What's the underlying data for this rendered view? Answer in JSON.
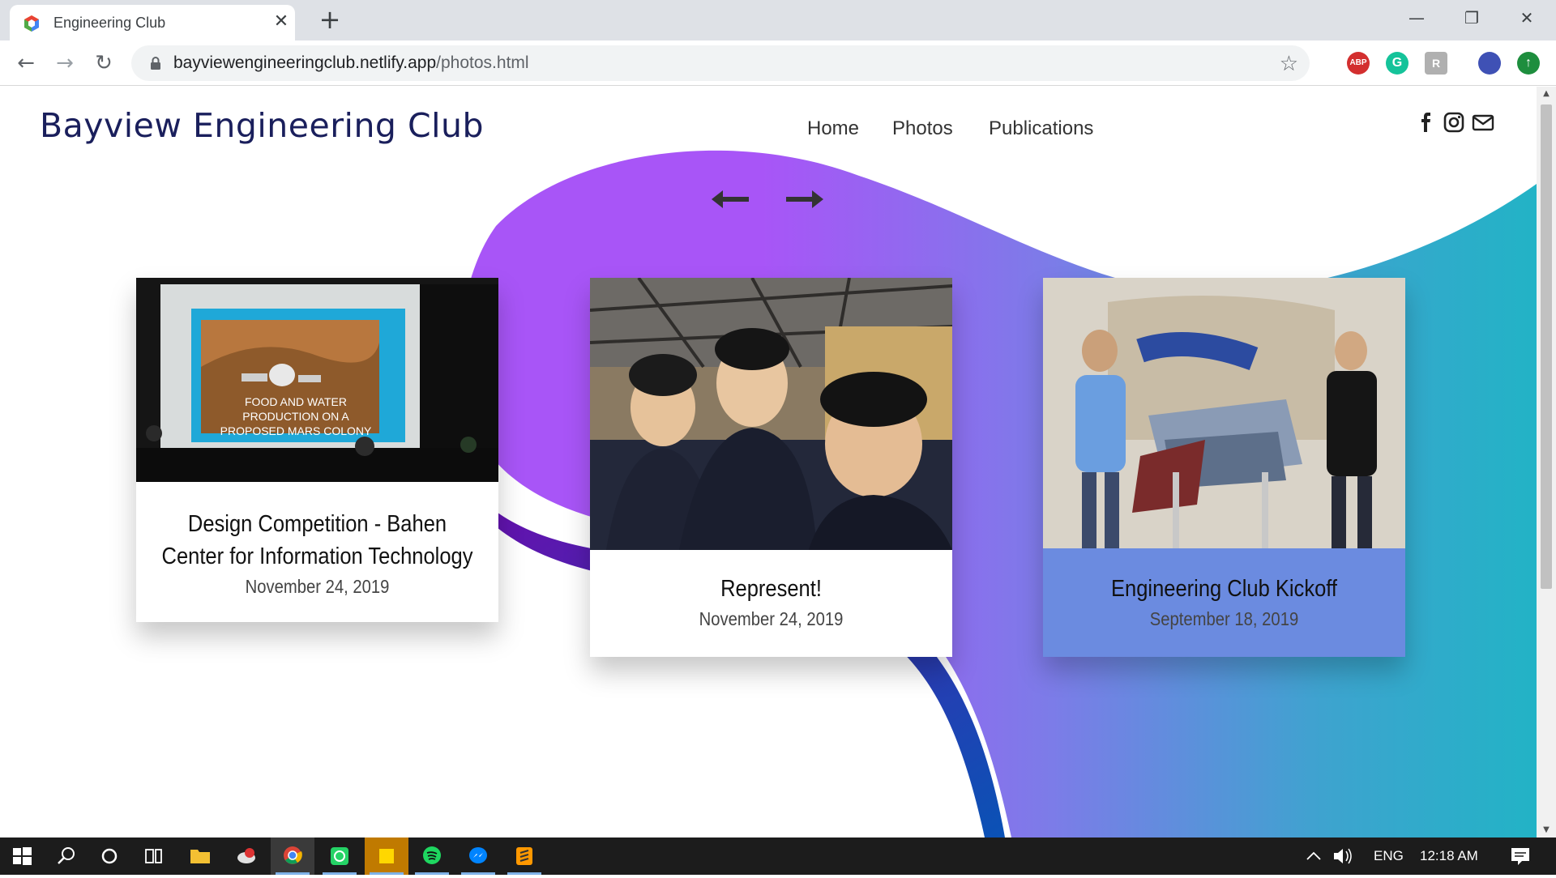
{
  "browser": {
    "tab_title": "Engineering Club",
    "tab_close": "✕",
    "new_tab": "+",
    "url_domain": "bayviewengineeringclub.netlify.app",
    "url_path": "/photos.html",
    "window_controls": {
      "minimize": "—",
      "restore": "❐",
      "close": "✕"
    },
    "nav": {
      "back": "←",
      "forward": "→",
      "reload": "↻"
    },
    "star": "☆",
    "extensions": [
      {
        "name": "adblock-plus-icon",
        "label": "ABP",
        "color": "#d32f2f"
      },
      {
        "name": "grammarly-icon",
        "label": "G",
        "color": "#15c39a"
      },
      {
        "name": "extension-icon",
        "label": "R",
        "color": "#b0b0b0"
      },
      {
        "name": "profile-avatar-icon",
        "label": "",
        "color": "#3f51b5"
      },
      {
        "name": "update-icon",
        "label": "↑",
        "color": "#1e8e3e"
      }
    ]
  },
  "site": {
    "title": "Bayview Engineering Club",
    "nav": [
      "Home",
      "Photos",
      "Publications"
    ],
    "arrows": {
      "prev": "prev-arrow",
      "next": "next-arrow"
    }
  },
  "cards": [
    {
      "title": "Design Competition - Bahen Center for Information Technology",
      "date": "November 24, 2019",
      "slide_text": "FOOD AND WATER PRODUCTION ON A PROPOSED MARS COLONY"
    },
    {
      "title": "Represent!",
      "date": "November 24, 2019"
    },
    {
      "title": "Engineering Club Kickoff",
      "date": "September 18, 2019"
    }
  ],
  "colors": {
    "brand_text": "#1a1f5c",
    "blob_start": "#a855f7",
    "blob_end": "#22b3c6",
    "band": "#4c1dba"
  },
  "taskbar": {
    "language": "ENG",
    "time": "12:18 AM"
  }
}
